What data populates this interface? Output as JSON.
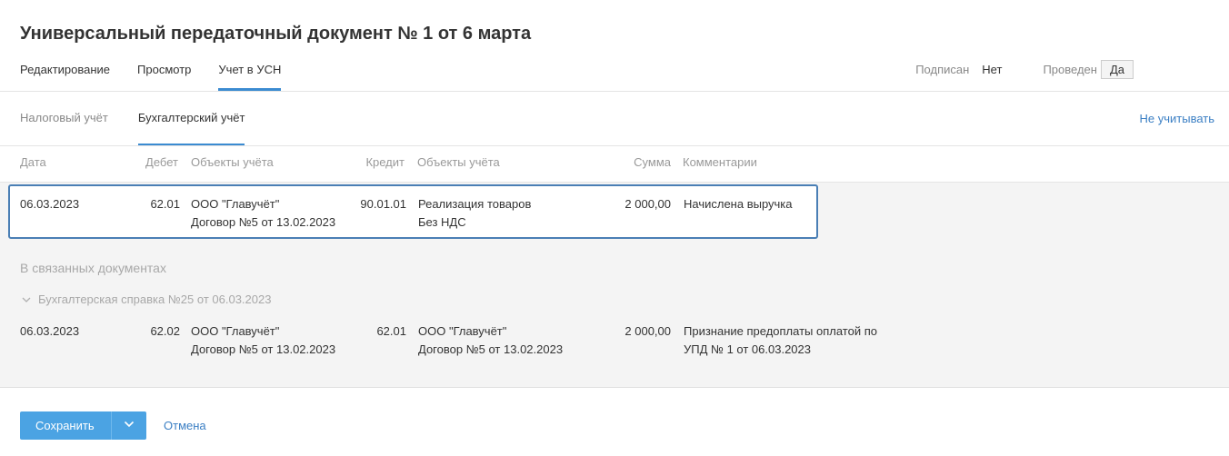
{
  "title": "Универсальный передаточный документ № 1 от 6 марта",
  "main_tabs": [
    {
      "label": "Редактирование"
    },
    {
      "label": "Просмотр"
    },
    {
      "label": "Учет в УСН"
    }
  ],
  "status": {
    "signed_label": "Подписан",
    "signed_value": "Нет",
    "posted_label": "Проведен",
    "posted_value": "Да"
  },
  "sub_tabs": [
    {
      "label": "Налоговый учёт"
    },
    {
      "label": "Бухгалтерский учёт"
    }
  ],
  "ignore_link": "Не учитывать",
  "columns": {
    "date": "Дата",
    "debit": "Дебет",
    "debit_objects": "Объекты учёта",
    "credit": "Кредит",
    "credit_objects": "Объекты учёта",
    "sum": "Сумма",
    "comments": "Комментарии"
  },
  "entry": {
    "date": "06.03.2023",
    "debit": "62.01",
    "debit_obj_1": "ООО \"Главучёт\"",
    "debit_obj_2": "Договор №5 от 13.02.2023",
    "credit": "90.01.01",
    "credit_obj_1": "Реализация товаров",
    "credit_obj_2": "Без НДС",
    "sum": "2 000,00",
    "comment": "Начислена выручка"
  },
  "linked": {
    "title": "В связанных документах",
    "doc_title": "Бухгалтерская справка №25 от 06.03.2023",
    "entry": {
      "date": "06.03.2023",
      "debit": "62.02",
      "debit_obj_1": "ООО \"Главучёт\"",
      "debit_obj_2": "Договор №5 от 13.02.2023",
      "credit": "62.01",
      "credit_obj_1": "ООО \"Главучёт\"",
      "credit_obj_2": "Договор №5 от 13.02.2023",
      "sum": "2 000,00",
      "comment_1": "Признание предоплаты оплатой по",
      "comment_2": "УПД № 1 от 06.03.2023"
    }
  },
  "actions": {
    "save": "Сохранить",
    "cancel": "Отмена"
  },
  "colors": {
    "accent": "#3b8bd1",
    "link": "#3b7fc4",
    "save_button": "#4ba3e3",
    "selected_border": "#4a7fb5"
  },
  "icons": {
    "save_dropdown": "chevron-down-icon",
    "linked_doc_toggle": "chevron-down-icon"
  }
}
